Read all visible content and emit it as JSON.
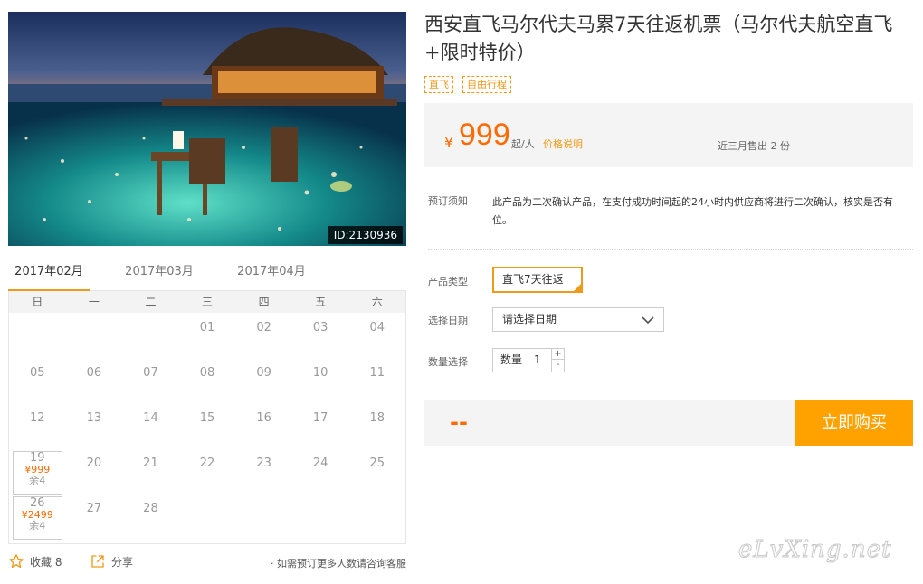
{
  "product": {
    "title": "西安直飞马尔代夫马累7天往返机票（马尔代夫航空直飞+限时特价）",
    "tags": [
      "直飞",
      "自由行程"
    ],
    "image_id": "ID:2130936"
  },
  "price": {
    "currency": "¥",
    "amount": "999",
    "unit": "起/人",
    "explain_link": "价格说明",
    "sold": "近三月售出 2 份"
  },
  "notice": {
    "label": "预订须知",
    "text": "此产品为二次确认产品，在支付成功时间起的24小时内供应商将进行二次确认，核实是否有位。"
  },
  "form": {
    "type_label": "产品类型",
    "type_value": "直飞7天往返",
    "date_label": "选择日期",
    "date_placeholder": "请选择日期",
    "qty_label": "数量选择",
    "qty_inner_label": "数量",
    "qty_value": "1",
    "plus": "+",
    "minus": "-"
  },
  "buy": {
    "total": "--",
    "button": "立即购买"
  },
  "calendar": {
    "months": [
      "2017年02月",
      "2017年03月",
      "2017年04月"
    ],
    "active_month": 0,
    "weekdays": [
      "日",
      "一",
      "二",
      "三",
      "四",
      "五",
      "六"
    ],
    "weeks": [
      [
        {
          "d": ""
        },
        {
          "d": ""
        },
        {
          "d": ""
        },
        {
          "d": "01"
        },
        {
          "d": "02"
        },
        {
          "d": "03"
        },
        {
          "d": "04"
        }
      ],
      [
        {
          "d": "05"
        },
        {
          "d": "06"
        },
        {
          "d": "07"
        },
        {
          "d": "08"
        },
        {
          "d": "09"
        },
        {
          "d": "10"
        },
        {
          "d": "11"
        }
      ],
      [
        {
          "d": "12"
        },
        {
          "d": "13"
        },
        {
          "d": "14"
        },
        {
          "d": "15"
        },
        {
          "d": "16"
        },
        {
          "d": "17"
        },
        {
          "d": "18"
        }
      ],
      [
        {
          "d": "19",
          "price": "¥999",
          "remain": "余4"
        },
        {
          "d": "20"
        },
        {
          "d": "21"
        },
        {
          "d": "22"
        },
        {
          "d": "23"
        },
        {
          "d": "24"
        },
        {
          "d": "25"
        }
      ],
      [
        {
          "d": "26",
          "price": "¥2499",
          "remain": "余4"
        },
        {
          "d": "27"
        },
        {
          "d": "28"
        },
        {
          "d": ""
        },
        {
          "d": ""
        },
        {
          "d": ""
        },
        {
          "d": ""
        }
      ]
    ]
  },
  "actions": {
    "favorite": "收藏 8",
    "share": "分享",
    "note": "· 如需预订更多人数请咨询客服"
  },
  "watermark": "eLvXing.net",
  "colors": {
    "accent": "#ff6a00",
    "orange": "#f09a1a",
    "buy_button": "#ffa200"
  },
  "icons": {
    "favorite": "star-icon",
    "share": "share-icon",
    "select": "chevron-down-icon"
  }
}
